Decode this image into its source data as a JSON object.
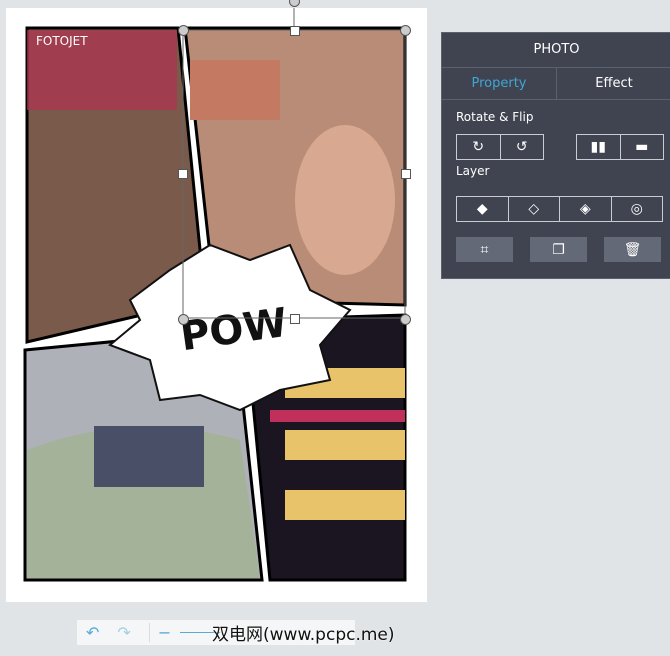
{
  "canvas": {
    "brand": "FOTOJET",
    "sticker_text": "POW"
  },
  "panel": {
    "title": "PHOTO",
    "tabs": [
      {
        "label": "Property",
        "active": true
      },
      {
        "label": "Effect",
        "active": false
      }
    ],
    "rotate_flip_label": "Rotate & Flip",
    "layer_label": "Layer",
    "accent": "#3fa6d6"
  },
  "toolbar": {
    "undo": "↶",
    "redo": "↷",
    "zoom_out": "−"
  },
  "watermark": "双电网(www.pcpc.me)"
}
